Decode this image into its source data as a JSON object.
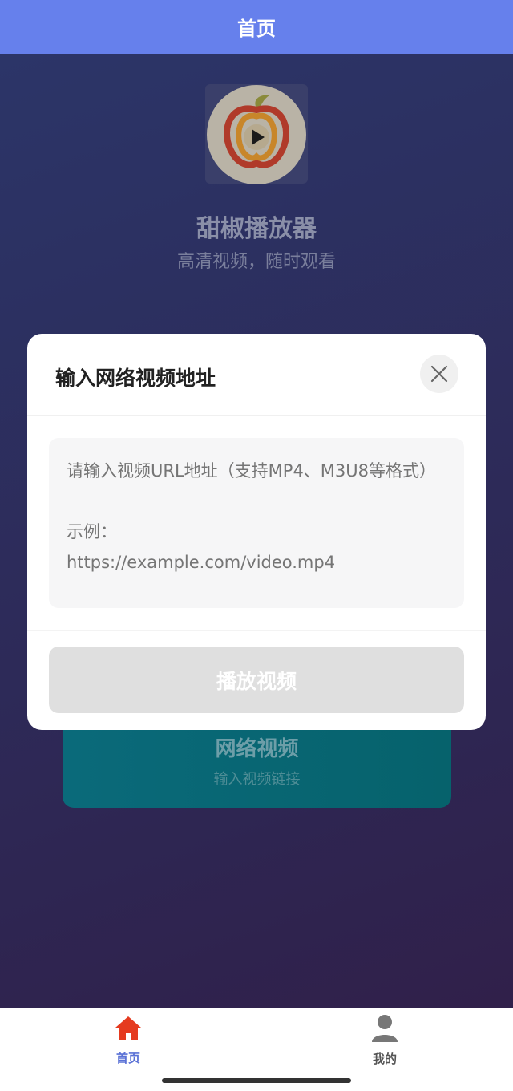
{
  "header": {
    "title": "首页"
  },
  "app": {
    "logo_icon": "pepper-play-logo",
    "name": "甜椒播放器",
    "slogan": "高清视频，随时观看"
  },
  "network_card": {
    "title": "网络视频",
    "subtitle": "输入视频链接"
  },
  "modal": {
    "title": "输入网络视频地址",
    "close_icon": "close-icon",
    "url_input": {
      "value": "",
      "placeholder": "请输入视频URL地址（支持MP4、M3U8等格式）\n\n示例：\nhttps://example.com/video.mp4"
    },
    "play_button_label": "播放视频"
  },
  "tabbar": {
    "items": [
      {
        "label": "首页",
        "icon": "home-icon",
        "active": true
      },
      {
        "label": "我的",
        "icon": "user-icon",
        "active": false
      }
    ]
  },
  "colors": {
    "header_bg": "#6680ec",
    "tab_active": "#5b72d6",
    "home_icon": "#e53a1f"
  }
}
